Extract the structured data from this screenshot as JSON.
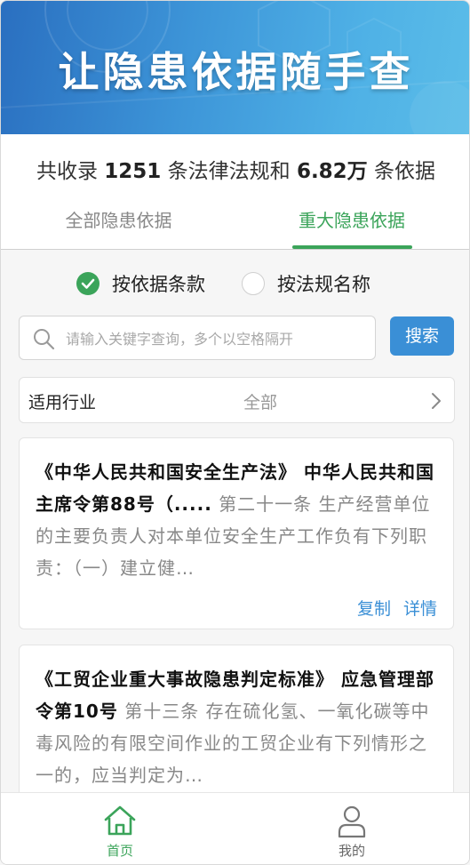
{
  "banner": {
    "title": "让隐患依据随手查"
  },
  "stats": {
    "prefix": "共收录",
    "law_count": "1251",
    "middle": "条法律法规和",
    "basis_count": "6.82万",
    "suffix": "条依据"
  },
  "tabs": [
    {
      "label": "全部隐患依据",
      "active": false
    },
    {
      "label": "重大隐患依据",
      "active": true
    }
  ],
  "search_mode": {
    "options": [
      {
        "label": "按依据条款",
        "selected": true
      },
      {
        "label": "按法规名称",
        "selected": false
      }
    ]
  },
  "search": {
    "placeholder": "请输入关键字查询，多个以空格隔开",
    "button_label": "搜索"
  },
  "industry_filter": {
    "label": "适用行业",
    "value": "全部"
  },
  "results": [
    {
      "law": "《中华人民共和国安全生产法》 中华人民共和国主席令第88号（.....",
      "excerpt": " 第二十一条 生产经营单位的主要负责人对本单位安全生产工作负有下列职责：（一）建立健…",
      "copy_label": "复制",
      "detail_label": "详情"
    },
    {
      "law": "《工贸企业重大事故隐患判定标准》 应急管理部令第10号",
      "excerpt": " 第十三条 存在硫化氢、一氧化碳等中毒风险的有限空间作业的工贸企业有下列情形之一的，应当判定为…"
    }
  ],
  "bottom_nav": [
    {
      "label": "首页",
      "icon": "home-icon",
      "active": true
    },
    {
      "label": "我的",
      "icon": "user-icon",
      "active": false
    }
  ],
  "colors": {
    "accent_green": "#3ba45a",
    "accent_blue": "#3a8fd6"
  }
}
